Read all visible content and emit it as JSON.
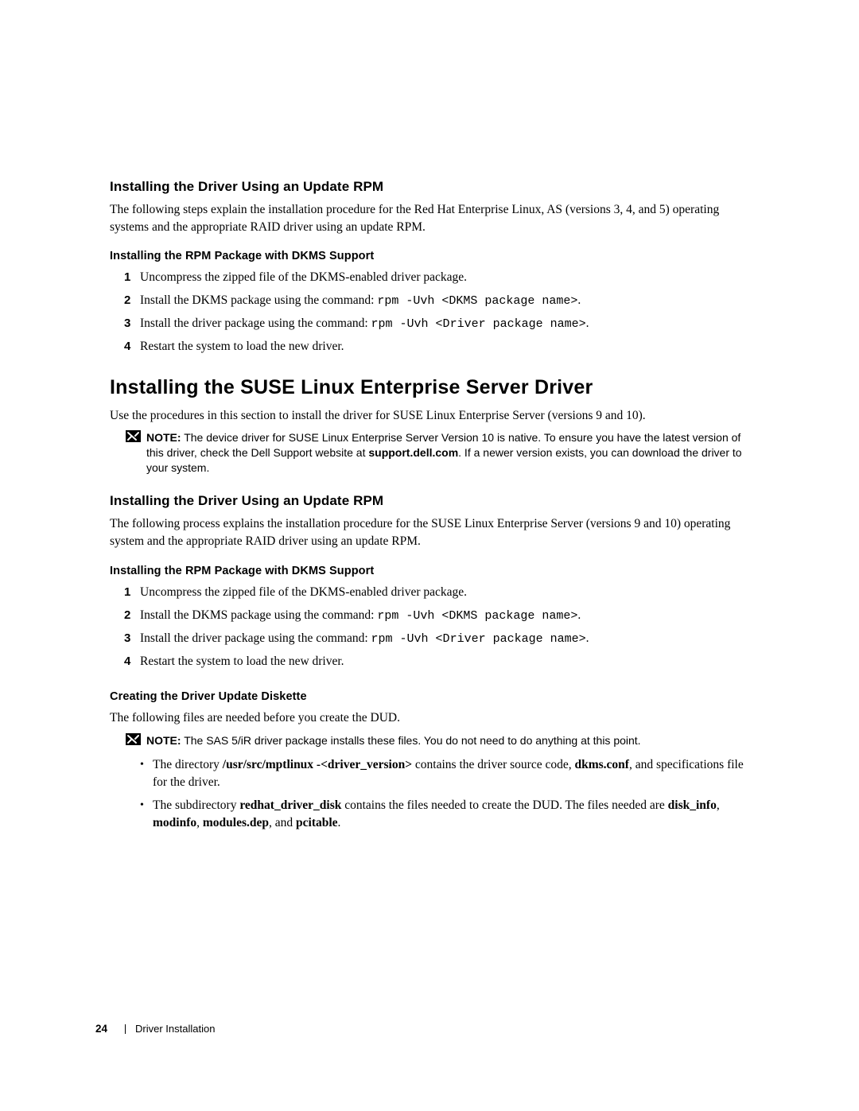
{
  "footer": {
    "page_num": "24",
    "section": "Driver Installation"
  },
  "rh": {
    "h2": "Installing the Driver Using an Update RPM",
    "para": "The following steps explain the installation procedure for the Red Hat Enterprise Linux, AS (versions 3, 4, and 5) operating systems and the appropriate RAID driver using an update RPM.",
    "h3": "Installing the RPM Package with DKMS Support",
    "s1": "Uncompress the zipped file of the DKMS-enabled driver package.",
    "s2_pre": "Install the DKMS package using the command: ",
    "s2_cmd": "rpm -Uvh <DKMS package name>",
    "s2_post": ".",
    "s3_pre": "Install the driver package using the command: ",
    "s3_cmd": "rpm -Uvh <Driver package name>",
    "s3_post": ".",
    "s4": "Restart the system to load the new driver."
  },
  "suse": {
    "h1": "Installing the SUSE Linux Enterprise Server Driver",
    "intro": "Use the procedures in this section to install the driver for SUSE Linux Enterprise Server (versions 9 and 10).",
    "note_label": "NOTE:",
    "note": "The device driver for SUSE Linux Enterprise Server Version 10 is native. To ensure you have the latest version of this driver, check the Dell Support website at ",
    "note_link": "support.dell.com",
    "note_after": ". If a newer version exists, you can download the driver to your system.",
    "h2": "Installing the Driver Using an Update RPM",
    "para": "The following process explains the installation procedure for the SUSE Linux Enterprise Server (versions 9 and 10) operating system and the appropriate RAID driver using an update RPM.",
    "h3": "Installing the RPM Package with DKMS Support",
    "s1": "Uncompress the zipped file of the DKMS-enabled driver package.",
    "s2_pre": "Install the DKMS package using the command: ",
    "s2_cmd": "rpm -Uvh <DKMS package name>",
    "s2_post": ".",
    "s3_pre": "Install the driver package using the command: ",
    "s3_cmd": "rpm -Uvh <Driver package name>",
    "s3_post": ".",
    "s4": "Restart the system to load the new driver."
  },
  "dud": {
    "h3": "Creating the Driver Update Diskette",
    "intro": "The following files are needed before you create the DUD.",
    "note_label": "NOTE:",
    "note": "The SAS 5/iR driver package installs these files. You do not need to do anything at this point.",
    "b1_pre": "The directory ",
    "b1_bold1": "/usr/src/mptlinux -<driver_version>",
    "b1_mid": " contains the driver source code, ",
    "b1_bold2": "dkms.conf",
    "b1_post": ", and specifications file for the driver.",
    "b2_pre": "The subdirectory ",
    "b2_bold1": "redhat_driver_disk",
    "b2_mid": " contains the files needed to create the DUD. The files needed are ",
    "b2_bold2": "disk_info",
    "b2_c1": ", ",
    "b2_bold3": "modinfo",
    "b2_c2": ", ",
    "b2_bold4": "modules.dep",
    "b2_c3": ", and ",
    "b2_bold5": "pcitable",
    "b2_post": "."
  }
}
